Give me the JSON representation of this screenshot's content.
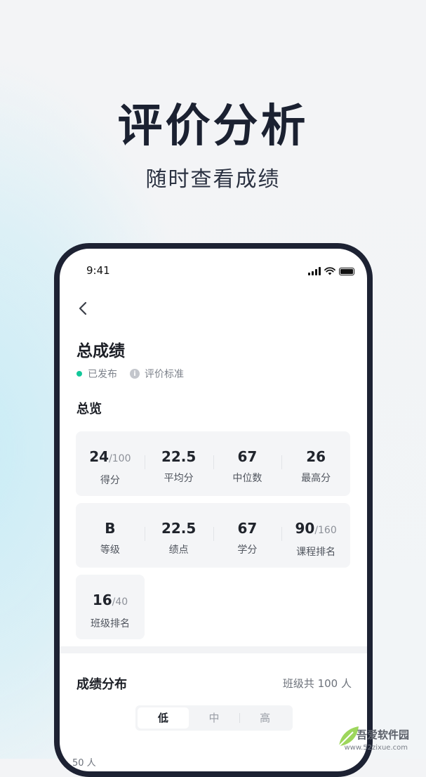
{
  "hero": {
    "title": "评价分析",
    "subtitle": "随时查看成绩"
  },
  "status_bar": {
    "time": "9:41",
    "icons": [
      "cellular-signal-icon",
      "wifi-icon",
      "battery-icon"
    ]
  },
  "nav": {
    "back_icon": "chevron-left-icon"
  },
  "page": {
    "title": "总成绩",
    "status": "已发布",
    "status_color": "#12c79a",
    "criteria_link": "评价标准",
    "overview_title": "总览"
  },
  "overview": {
    "row1": [
      {
        "value": "24",
        "denom": "/100",
        "label": "得分"
      },
      {
        "value": "22.5",
        "denom": "",
        "label": "平均分"
      },
      {
        "value": "67",
        "denom": "",
        "label": "中位数"
      },
      {
        "value": "26",
        "denom": "",
        "label": "最高分"
      }
    ],
    "row2": [
      {
        "value": "B",
        "denom": "",
        "label": "等级"
      },
      {
        "value": "22.5",
        "denom": "",
        "label": "绩点"
      },
      {
        "value": "67",
        "denom": "",
        "label": "学分"
      },
      {
        "value": "90",
        "denom": "/160",
        "label": "课程排名"
      }
    ],
    "row3": [
      {
        "value": "16",
        "denom": "/40",
        "label": "班级排名"
      }
    ]
  },
  "distribution": {
    "title": "成绩分布",
    "count": "班级共 100 人",
    "tabs": [
      {
        "label": "低",
        "active": true
      },
      {
        "label": "中",
        "active": false
      },
      {
        "label": "高",
        "active": false
      }
    ],
    "y_label": "50 人"
  },
  "watermark": {
    "text": "吾爱软件园",
    "url": "www.52zixue.com"
  },
  "colors": {
    "accent_green": "#12c79a",
    "dark_text": "#1b2131",
    "phone_frame": "#1d2233"
  }
}
